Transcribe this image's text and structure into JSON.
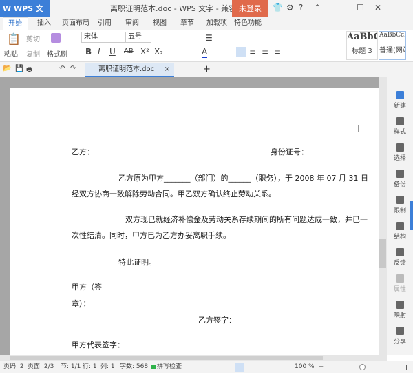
{
  "app": {
    "logo": "W WPS 文字",
    "title": "离职证明范本.doc - WPS 文字 - 兼容模式",
    "login": "未登录"
  },
  "tabs": [
    "开始",
    "插入",
    "页面布局",
    "引用",
    "审阅",
    "视图",
    "章节",
    "加载项",
    "特色功能"
  ],
  "ribbon": {
    "paste": "粘贴",
    "cut": "剪切",
    "copy": "复制",
    "format_painter": "格式刷",
    "font": "宋体",
    "size": "五号",
    "styles": [
      "AaBbC",
      "AaBbCcD"
    ],
    "style_names": [
      "标题 3",
      "普通(网站)"
    ]
  },
  "doc_tab": "离职证明范本.doc",
  "document": {
    "lines": [
      "乙方：",
      "身份证号：",
      "乙方原为甲方_______（部门）的______（职务），于 2008 年 07 月 31 日",
      "经双方协商一致解除劳动合同。甲乙双方确认终止劳动关系。",
      "双方现已就经济补偿金及劳动关系存续期间的所有问题达成一致，并已一",
      "次性结清。同时，甲方已为乙方办妥离职手续。",
      "特此证明。",
      "甲方（签",
      "章）：",
      "乙方签字：",
      "甲方代表签字："
    ]
  },
  "sidebar": [
    "新建",
    "样式",
    "选择",
    "备份",
    "限制",
    "结构",
    "反馈",
    "属性",
    "映射",
    "分享"
  ],
  "status": {
    "page": "页码: 2",
    "pages": "页面: 2/3",
    "section": "节: 1/1",
    "row": "行: 1",
    "col": "列: 1",
    "words": "字数: 568",
    "spell": "拼写检查",
    "zoom": "100 %"
  },
  "zoom_level": 100,
  "accent": "#3c7fd8",
  "login_color": "#e06a4b"
}
